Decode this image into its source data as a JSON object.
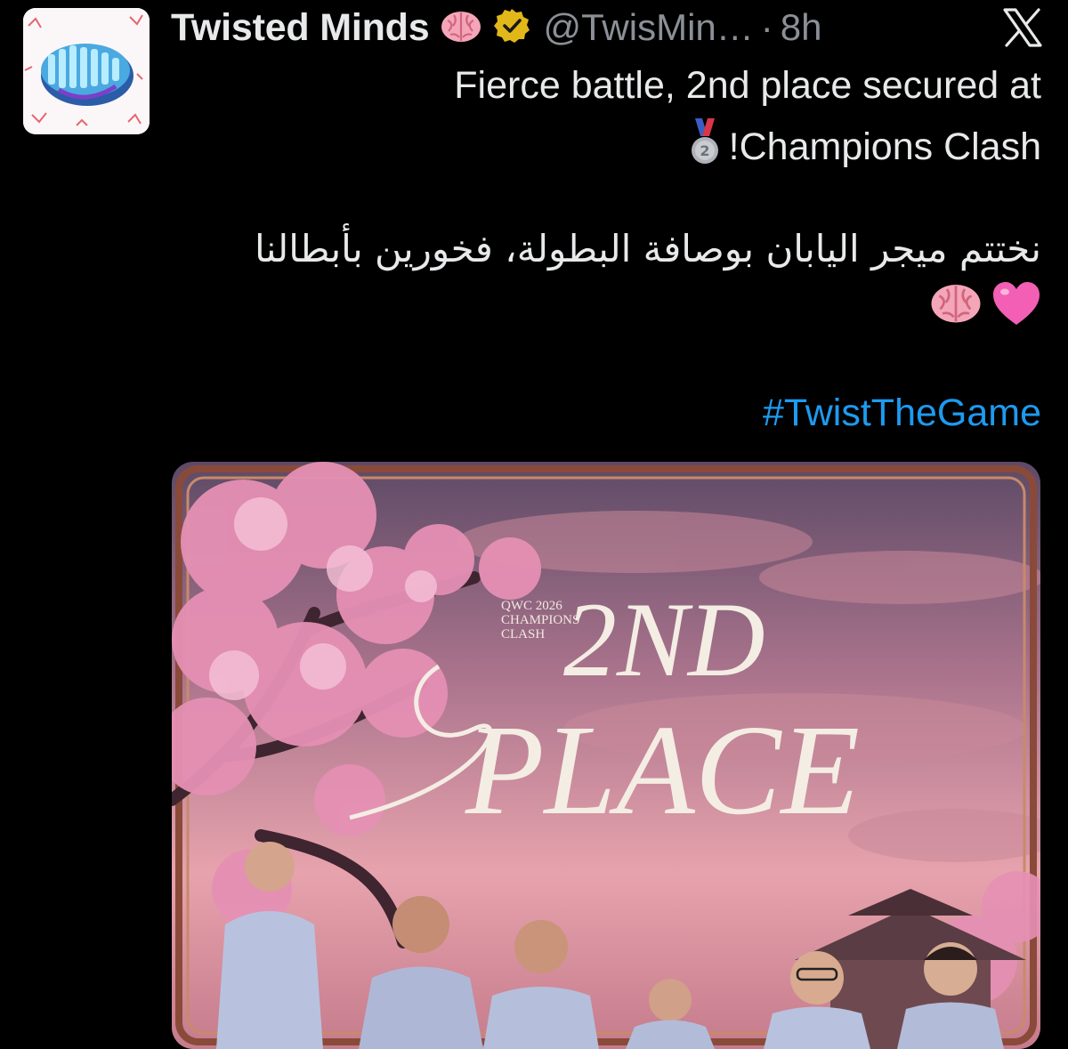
{
  "tweet": {
    "author_name": "Twisted Minds",
    "handle": "@TwisMin…",
    "separator": "·",
    "time": "8h",
    "text_line_1": "Fierce battle, 2nd place secured at",
    "text_line_2": "!Champions Clash",
    "text_arabic": "نختتم ميجر اليابان بوصافة البطولة، فخورين بأبطالنا",
    "hashtag": "#TwistTheGame"
  },
  "poster": {
    "event_line_1": "QWC 2026",
    "event_line_2": "CHAMPIONS",
    "event_line_3": "CLASH",
    "headline_1": "2ND",
    "headline_2": "PLACE"
  },
  "colors": {
    "background": "#000000",
    "text": "#e7e9ea",
    "muted": "#8b9096",
    "link": "#1d9bf0",
    "verified_gold": "#e2b719"
  },
  "icons": {
    "author_emoji": "brain-emoji",
    "verified": "verified-badge-icon",
    "platform": "x-logo-icon",
    "medal": "second-place-medal-emoji",
    "heart": "pink-heart-emoji"
  }
}
